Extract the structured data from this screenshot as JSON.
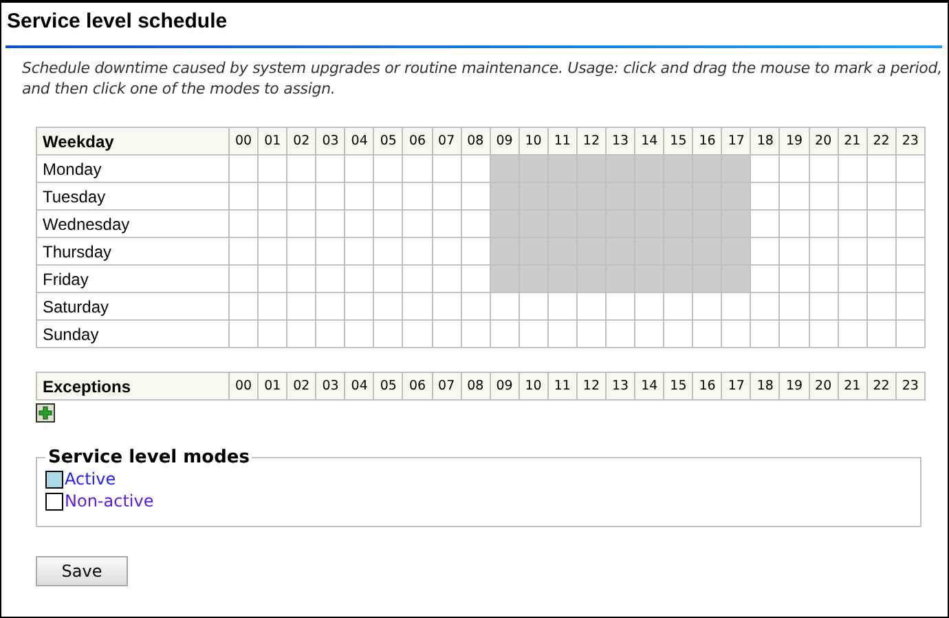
{
  "title": "Service level schedule",
  "description": "Schedule downtime caused by system upgrades or routine maintenance. Usage: click and drag the mouse to mark a period, and then click one of the modes to assign.",
  "schedule": {
    "label_heading": "Weekday",
    "hours": [
      "00",
      "01",
      "02",
      "03",
      "04",
      "05",
      "06",
      "07",
      "08",
      "09",
      "10",
      "11",
      "12",
      "13",
      "14",
      "15",
      "16",
      "17",
      "18",
      "19",
      "20",
      "21",
      "22",
      "23"
    ],
    "days": [
      {
        "name": "Monday",
        "slots": [
          false,
          false,
          false,
          false,
          false,
          false,
          false,
          false,
          false,
          true,
          true,
          true,
          true,
          true,
          true,
          true,
          true,
          true,
          false,
          false,
          false,
          false,
          false,
          false
        ]
      },
      {
        "name": "Tuesday",
        "slots": [
          false,
          false,
          false,
          false,
          false,
          false,
          false,
          false,
          false,
          true,
          true,
          true,
          true,
          true,
          true,
          true,
          true,
          true,
          false,
          false,
          false,
          false,
          false,
          false
        ]
      },
      {
        "name": "Wednesday",
        "slots": [
          false,
          false,
          false,
          false,
          false,
          false,
          false,
          false,
          false,
          true,
          true,
          true,
          true,
          true,
          true,
          true,
          true,
          true,
          false,
          false,
          false,
          false,
          false,
          false
        ]
      },
      {
        "name": "Thursday",
        "slots": [
          false,
          false,
          false,
          false,
          false,
          false,
          false,
          false,
          false,
          true,
          true,
          true,
          true,
          true,
          true,
          true,
          true,
          true,
          false,
          false,
          false,
          false,
          false,
          false
        ]
      },
      {
        "name": "Friday",
        "slots": [
          false,
          false,
          false,
          false,
          false,
          false,
          false,
          false,
          false,
          true,
          true,
          true,
          true,
          true,
          true,
          true,
          true,
          true,
          false,
          false,
          false,
          false,
          false,
          false
        ]
      },
      {
        "name": "Saturday",
        "slots": [
          false,
          false,
          false,
          false,
          false,
          false,
          false,
          false,
          false,
          false,
          false,
          false,
          false,
          false,
          false,
          false,
          false,
          false,
          false,
          false,
          false,
          false,
          false,
          false
        ]
      },
      {
        "name": "Sunday",
        "slots": [
          false,
          false,
          false,
          false,
          false,
          false,
          false,
          false,
          false,
          false,
          false,
          false,
          false,
          false,
          false,
          false,
          false,
          false,
          false,
          false,
          false,
          false,
          false,
          false
        ]
      }
    ]
  },
  "exceptions": {
    "label_heading": "Exceptions",
    "hours": [
      "00",
      "01",
      "02",
      "03",
      "04",
      "05",
      "06",
      "07",
      "08",
      "09",
      "10",
      "11",
      "12",
      "13",
      "14",
      "15",
      "16",
      "17",
      "18",
      "19",
      "20",
      "21",
      "22",
      "23"
    ]
  },
  "modes": {
    "legend": "Service level modes",
    "items": [
      {
        "label": "Active",
        "color": "#add8e6"
      },
      {
        "label": "Non-active",
        "color": "#ffffff"
      }
    ]
  },
  "save_button": "Save"
}
